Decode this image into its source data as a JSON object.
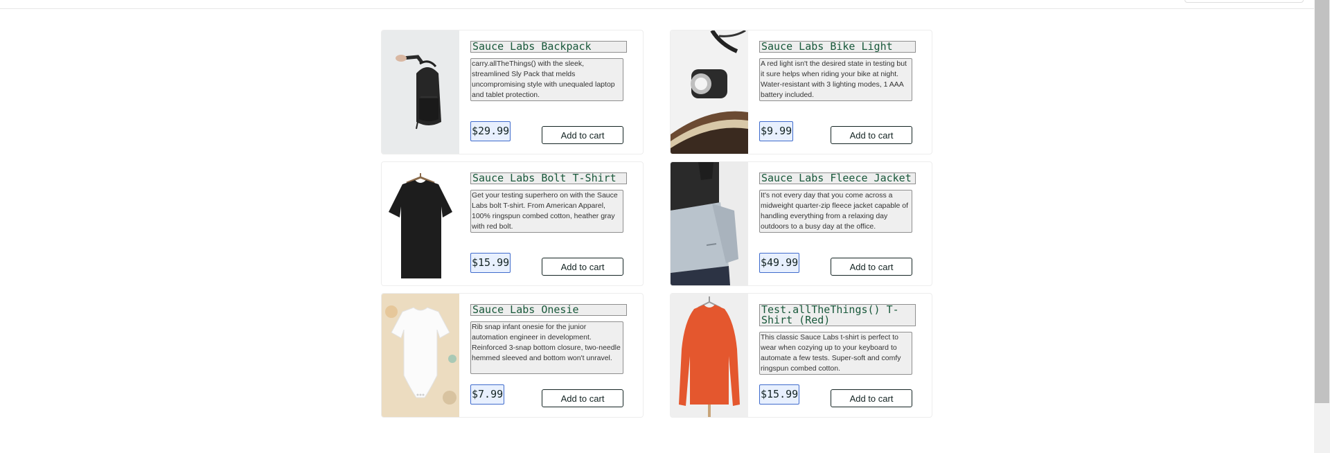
{
  "products": [
    {
      "name": "Sauce Labs Backpack",
      "description": "carry.allTheThings() with the sleek, streamlined Sly Pack that melds uncompromising style with unequaled laptop and tablet protection.",
      "price": "$29.99",
      "button": "Add to cart"
    },
    {
      "name": "Sauce Labs Bike Light",
      "description": "A red light isn't the desired state in testing but it sure helps when riding your bike at night. Water-resistant with 3 lighting modes, 1 AAA battery included.",
      "price": "$9.99",
      "button": "Add to cart"
    },
    {
      "name": "Sauce Labs Bolt T-Shirt",
      "description": "Get your testing superhero on with the Sauce Labs bolt T-shirt. From American Apparel, 100% ringspun combed cotton, heather gray with red bolt.",
      "price": "$15.99",
      "button": "Add to cart"
    },
    {
      "name": "Sauce Labs Fleece Jacket",
      "description": "It's not every day that you come across a midweight quarter-zip fleece jacket capable of handling everything from a relaxing day outdoors to a busy day at the office.",
      "price": "$49.99",
      "button": "Add to cart"
    },
    {
      "name": "Sauce Labs Onesie",
      "description": "Rib snap infant onesie for the junior automation engineer in development. Reinforced 3-snap bottom closure, two-needle hemmed sleeved and bottom won't unravel.",
      "price": "$7.99",
      "button": "Add to cart"
    },
    {
      "name": "Test.allTheThings() T-Shirt (Red)",
      "description": "This classic Sauce Labs t-shirt is perfect to wear when cozying up to your keyboard to automate a few tests. Super-soft and comfy ringspun combed cotton.",
      "price": "$15.99",
      "button": "Add to cart"
    }
  ]
}
